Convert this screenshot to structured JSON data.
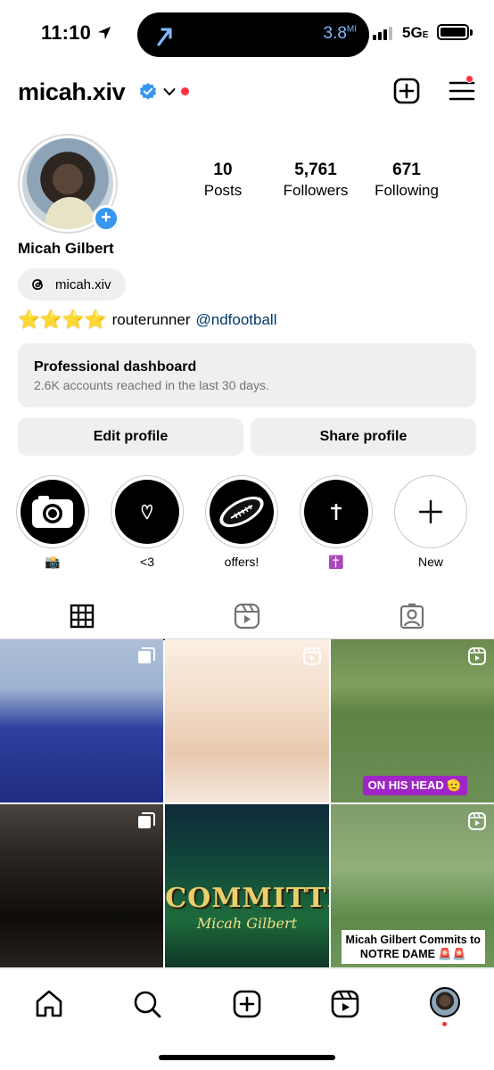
{
  "status_bar": {
    "time": "11:10",
    "distance": "3.8",
    "distance_unit": "MI",
    "network": "5G",
    "network_suffix": "E"
  },
  "header": {
    "username": "micah.xiv",
    "icons": [
      "verified-badge-icon",
      "chevron-down-icon",
      "create-plus-icon",
      "menu-icon"
    ]
  },
  "profile": {
    "full_name": "Micah Gilbert",
    "threads_handle": "micah.xiv",
    "bio_stars": "⭐⭐⭐⭐",
    "bio_text": "routerunner",
    "bio_mention": "@ndfootball",
    "stats": [
      {
        "value": "10",
        "label": "Posts"
      },
      {
        "value": "5,761",
        "label": "Followers"
      },
      {
        "value": "671",
        "label": "Following"
      }
    ]
  },
  "dashboard": {
    "title": "Professional dashboard",
    "subtitle": "2.6K accounts reached in the last 30 days."
  },
  "buttons": {
    "edit": "Edit profile",
    "share": "Share profile"
  },
  "highlights": [
    {
      "label": "📸",
      "icon": "camera-icon"
    },
    {
      "label": "<3",
      "icon": "heart-doodle-icon"
    },
    {
      "label": "offers!",
      "icon": "football-icon"
    },
    {
      "label": "✝️",
      "icon": "cross-icon"
    },
    {
      "label": "New",
      "icon": "plus-icon"
    }
  ],
  "posts": [
    {
      "type": "carousel"
    },
    {
      "type": "reel"
    },
    {
      "type": "reel",
      "tag": "ON HIS HEAD 🫡"
    },
    {
      "type": "carousel"
    },
    {
      "type": "image",
      "overlay_word": "COMMITTED",
      "overlay_name": "Micah Gilbert"
    },
    {
      "type": "reel",
      "caption": "Micah Gilbert Commits to NOTRE DAME 🚨🚨"
    }
  ],
  "colors": {
    "accent_blue": "#3797f0",
    "notification_red": "#ff3040",
    "mention": "#00376b",
    "tag_purple": "#a025c6"
  }
}
